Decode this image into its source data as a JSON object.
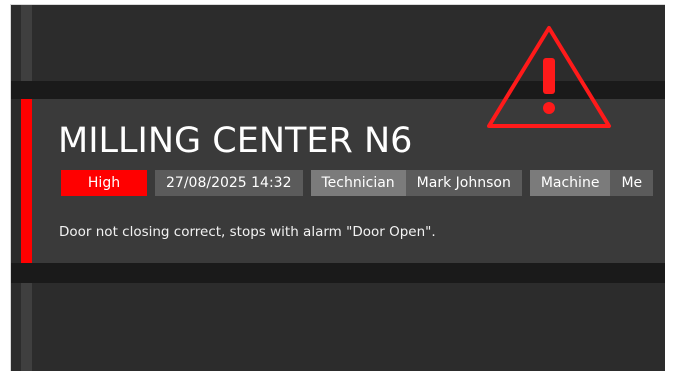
{
  "card": {
    "title": "MILLING CENTER N6",
    "priority": "High",
    "datetime": "27/08/2025 14:32",
    "technician_label": "Technician",
    "technician_value": "Mark Johnson",
    "machine_label": "Machine",
    "machine_value_partial": "Me",
    "description": "Door not closing correct, stops with alarm \"Door Open\"."
  },
  "icons": {
    "warning": "warning-triangle-icon"
  },
  "colors": {
    "alert": "#ff0000",
    "card_bg": "#3a3a3a",
    "page_bg": "#2b2b2b"
  }
}
